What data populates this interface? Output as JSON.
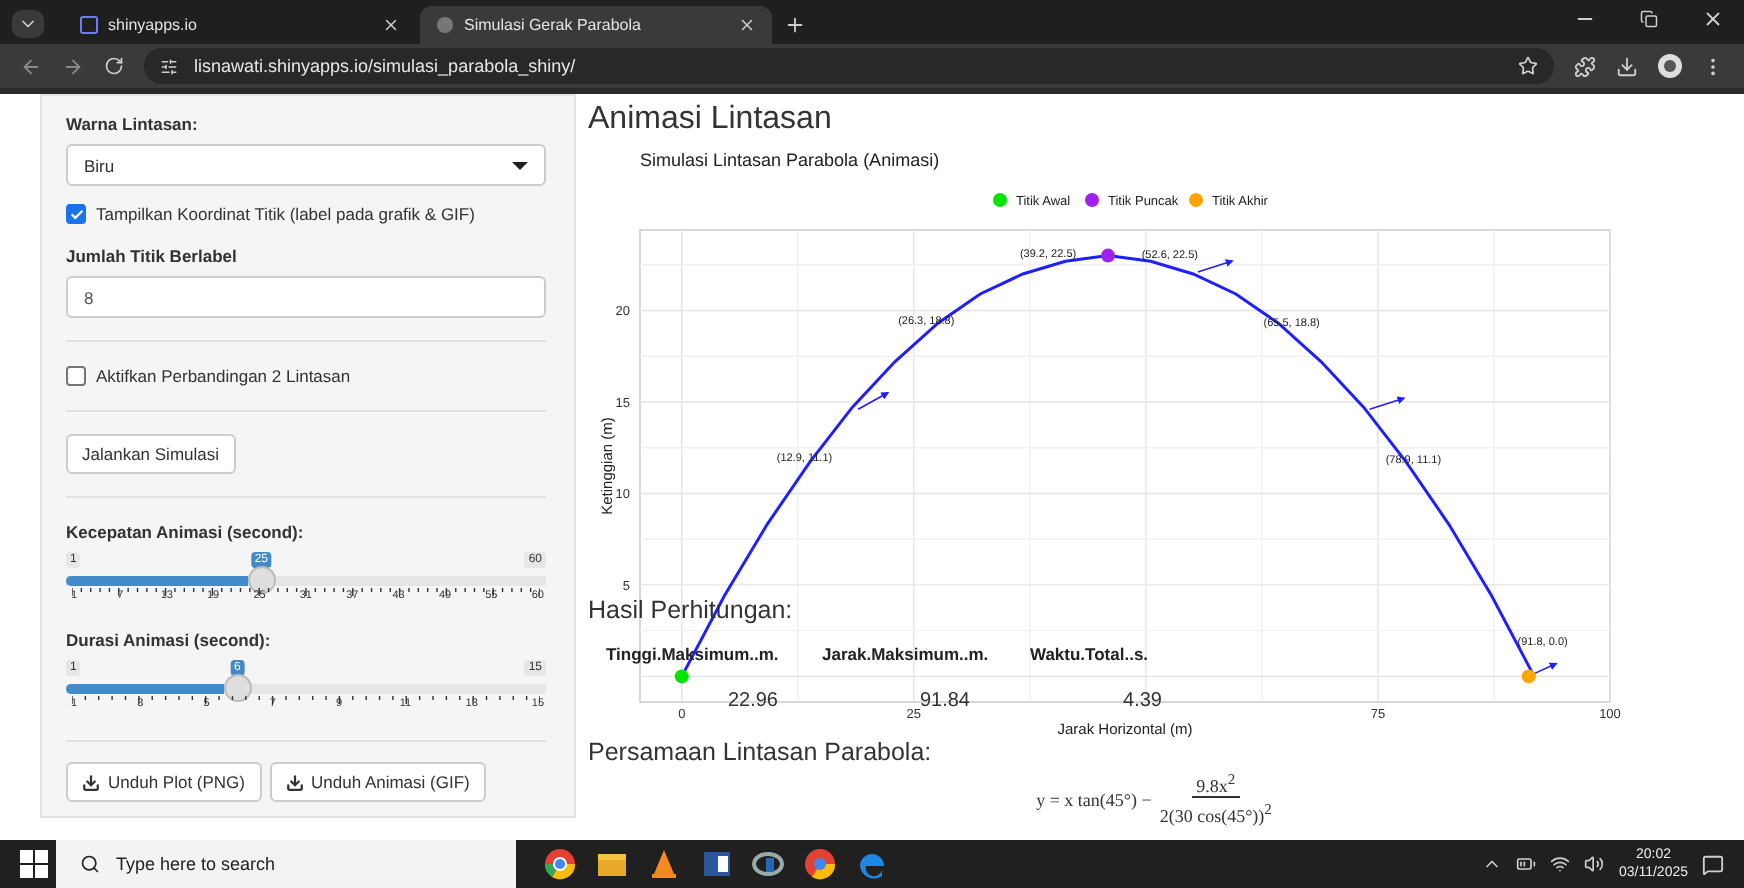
{
  "browser": {
    "tabs": [
      {
        "title": "shinyapps.io",
        "selected": false
      },
      {
        "title": "Simulasi Gerak Parabola",
        "selected": true
      }
    ],
    "url": "lisnawati.shinyapps.io/simulasi_parabola_shiny/"
  },
  "sidebar": {
    "color_field": {
      "label": "Warna Lintasan:",
      "value": "Biru"
    },
    "show_coords": {
      "label": "Tampilkan Koordinat Titik (label pada grafik & GIF)",
      "checked": true
    },
    "labeled_points": {
      "label": "Jumlah Titik Berlabel",
      "value": "8"
    },
    "compare": {
      "label": "Aktifkan Perbandingan 2 Lintasan",
      "checked": false
    },
    "run_button": "Jalankan Simulasi",
    "sliders": [
      {
        "label": "Kecepatan Animasi (second):",
        "min": "1",
        "max": "60",
        "value": "25",
        "level": 0.407,
        "ticks": [
          "1",
          "7",
          "13",
          "19",
          "25",
          "31",
          "37",
          "43",
          "49",
          "55",
          "60"
        ]
      },
      {
        "label": "Durasi Animasi (second):",
        "min": "1",
        "max": "15",
        "value": "6",
        "level": 0.357,
        "ticks": [
          "1",
          "3",
          "5",
          "7",
          "9",
          "11",
          "13",
          "15"
        ]
      }
    ],
    "download_buttons": [
      "Unduh Plot (PNG)",
      "Unduh Animasi (GIF)"
    ]
  },
  "main": {
    "title": "Animasi Lintasan",
    "chart": {
      "chart_data": {
        "type": "line",
        "title": "Simulasi Lintasan Parabola (Animasi)",
        "xlabel": "Jarak Horizontal (m)",
        "ylabel": "Ketinggian (m)",
        "x": [
          0,
          4.592,
          9.184,
          13.776,
          18.368,
          22.96,
          27.552,
          32.144,
          36.736,
          41.328,
          45.92,
          50.512,
          55.104,
          59.696,
          64.288,
          68.88,
          73.472,
          78.064,
          82.656,
          87.248,
          91.84
        ],
        "series": [
          {
            "color": "#1f1fff",
            "values": [
              0,
              4.4,
              8.3,
              11.7,
              14.7,
              17.2,
              19.3,
              20.9,
              22.0,
              22.7,
              23.0,
              22.7,
              22.0,
              20.9,
              19.3,
              17.2,
              14.7,
              11.7,
              8.3,
              4.4,
              0
            ]
          }
        ],
        "xlim": [
          -4.5,
          100
        ],
        "ylim": [
          -1.4,
          24.4
        ],
        "xticks": [
          0,
          25,
          75,
          100
        ],
        "yticks": [
          5,
          10,
          15,
          20
        ],
        "grid": true,
        "annotations": [
          "(12.9, 11.1)",
          "(26.3, 18.8)",
          "(39.2, 22.5)",
          "(52.6, 22.5)",
          "(65.5, 18.8)",
          "(78.9, 11.1)",
          "(91.8, 0.0)"
        ]
      },
      "markers": [
        {
          "label": "Titik Awal",
          "color": "#00e600",
          "kind": "start"
        },
        {
          "label": "Titik Puncak",
          "color": "#a020f0",
          "kind": "peak"
        },
        {
          "label": "Titik Akhir",
          "color": "#ffa500",
          "kind": "end"
        }
      ]
    },
    "results": {
      "title": "Hasil Perhitungan:",
      "columns": [
        "Tinggi.Maksimum..m.",
        "Jarak.Maksimum..m.",
        "Waktu.Total..s."
      ],
      "values": [
        "22.96",
        "91.84",
        "4.39"
      ]
    },
    "equation": {
      "title": "Persamaan Lintasan Parabola:",
      "lhs": "y = x tan(45°) −",
      "numerator": "9.8x$^{2}$",
      "denominator": "2(30 cos(45°))$^{2}$"
    }
  },
  "taskbar": {
    "search_placeholder": "Type here to search",
    "time": "20:02",
    "date": "03/11/2025"
  }
}
